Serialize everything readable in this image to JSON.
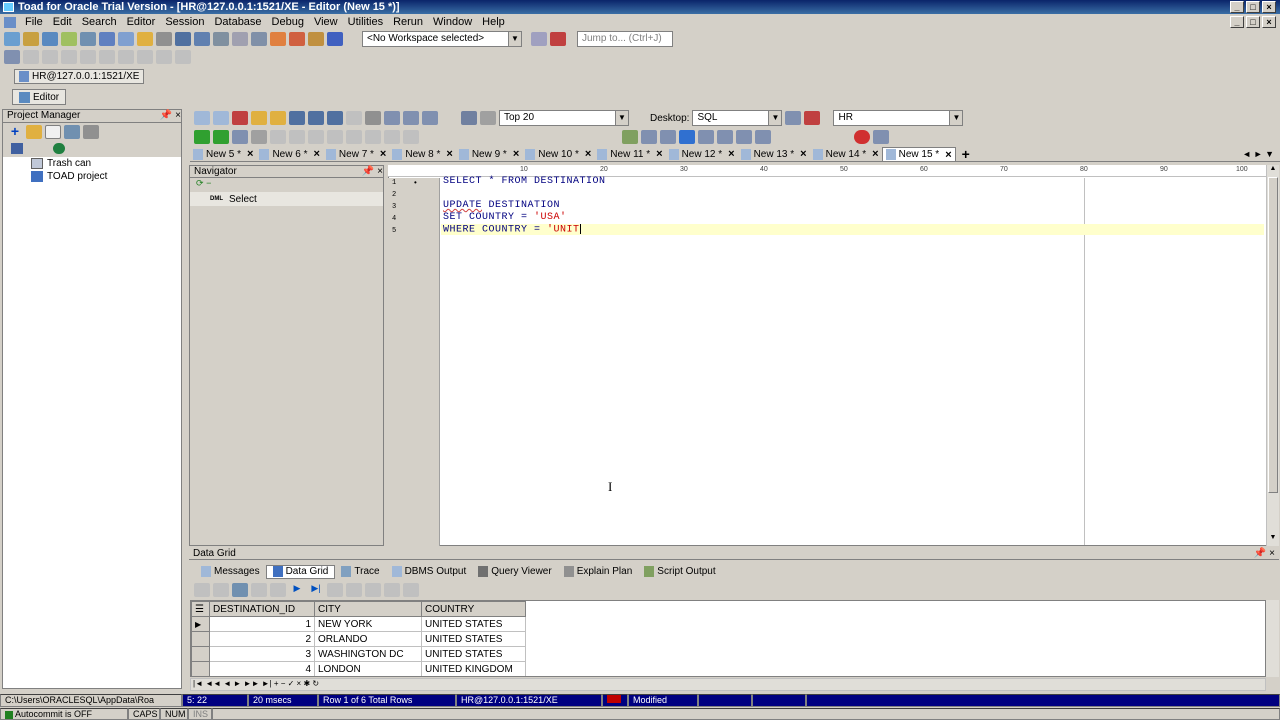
{
  "window": {
    "title": "Toad for Oracle Trial Version - [HR@127.0.0.1:1521/XE - Editor (New 15 *)]"
  },
  "menu": [
    "File",
    "Edit",
    "Search",
    "Editor",
    "Session",
    "Database",
    "Debug",
    "View",
    "Utilities",
    "Rerun",
    "Window",
    "Help"
  ],
  "toolbar": {
    "workspace": "<No Workspace selected>",
    "jump_placeholder": "Jump to... (Ctrl+J)"
  },
  "connection_tab": "HR@127.0.0.1:1521/XE",
  "editor_button": "Editor",
  "project_manager": {
    "title": "Project Manager",
    "items": [
      "Trash can",
      "TOAD project"
    ]
  },
  "editor_toolbar": {
    "top_rows": "Top 20",
    "desktop_label": "Desktop:",
    "desktop_value": "SQL",
    "schema": "HR"
  },
  "editor_tabs": [
    "New 5 *",
    "New 6 *",
    "New 7 *",
    "New 8 *",
    "New 9 *",
    "New 10 *",
    "New 11 *",
    "New 12 *",
    "New 13 *",
    "New 14 *",
    "New 15 *"
  ],
  "navigator": {
    "title": "Navigator",
    "items": [
      {
        "tag": "DML",
        "label": "Select"
      }
    ]
  },
  "ruler": [
    "10",
    "20",
    "30",
    "40",
    "50",
    "60",
    "70",
    "80",
    "90",
    "100"
  ],
  "sql": {
    "line_numbers": [
      "1",
      "2",
      "3",
      "4",
      "5"
    ],
    "line1": "SELECT * FROM DESTINATION",
    "line3_kw": "UPDATE",
    "line3_rest": " DESTINATION",
    "line4_kw": "SET COUNTRY = ",
    "line4_str": "'USA'",
    "line5_kw": "WHERE COUNTRY = ",
    "line5_str": "'UNIT"
  },
  "data_grid": {
    "title": "Data Grid",
    "tabs": [
      "Messages",
      "Data Grid",
      "Trace",
      "DBMS Output",
      "Query Viewer",
      "Explain Plan",
      "Script Output"
    ],
    "columns": [
      "DESTINATION_ID",
      "CITY",
      "COUNTRY"
    ],
    "rows": [
      [
        "1",
        "NEW YORK",
        "UNITED STATES"
      ],
      [
        "2",
        "ORLANDO",
        "UNITED STATES"
      ],
      [
        "3",
        "WASHINGTON DC",
        "UNITED STATES"
      ],
      [
        "4",
        "LONDON",
        "UNITED KINGDOM"
      ]
    ]
  },
  "status": {
    "path": "C:\\Users\\ORACLESQL\\AppData\\Roa",
    "pos": "5: 22",
    "time": "20 msecs",
    "rows": "Row 1 of 6 Total Rows",
    "conn": "HR@127.0.0.1:1521/XE",
    "modified": "Modified",
    "autocommit": "Autocommit is OFF",
    "caps": "CAPS",
    "num": "NUM",
    "ins": "INS"
  },
  "colors": {
    "titlebar": "#0a246a",
    "highlight_line": "#ffffcc",
    "sql_text": "#000080",
    "sql_string": "#cc0000"
  }
}
